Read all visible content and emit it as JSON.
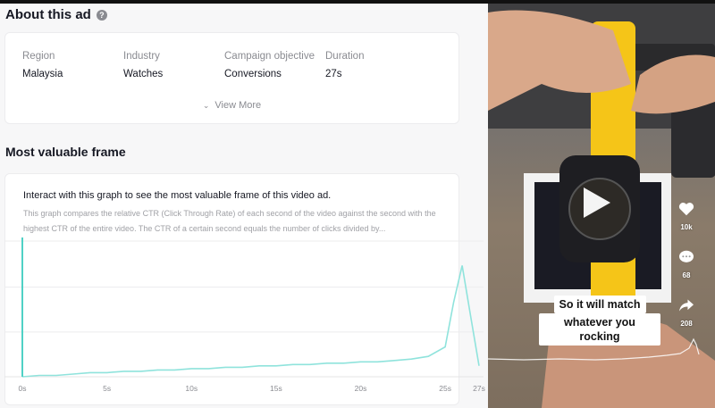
{
  "about": {
    "title": "About this ad",
    "help_icon": "help-icon",
    "fields": [
      {
        "label": "Region",
        "value": "Malaysia"
      },
      {
        "label": "Industry",
        "value": "Watches"
      },
      {
        "label": "Campaign objective",
        "value": "Conversions"
      },
      {
        "label": "Duration",
        "value": "27s"
      }
    ],
    "view_more": "View More"
  },
  "frame": {
    "title": "Most valuable frame",
    "card_title": "Interact with this graph to see the most valuable frame of this video ad.",
    "description": "This graph compares the relative CTR (Click Through Rate) of each second of the video against the second with the highest CTR of the entire video. The CTR of a certain second equals the number of clicks divided by..."
  },
  "colors": {
    "line": "#8fe3dc",
    "marker": "#4fd1c5",
    "brand_yellow": "#f5c518"
  },
  "chart_data": {
    "type": "line",
    "x_ticks": [
      "0s",
      "5s",
      "10s",
      "15s",
      "20s",
      "25s",
      "27s"
    ],
    "x_tick_values": [
      0,
      5,
      10,
      15,
      20,
      25,
      27
    ],
    "xlim": [
      0,
      27
    ],
    "ylim": [
      0,
      100
    ],
    "grid": true,
    "series": [
      {
        "x": [
          0,
          1,
          2,
          3,
          4,
          5,
          6,
          7,
          8,
          9,
          10,
          11,
          12,
          13,
          14,
          15,
          16,
          17,
          18,
          19,
          20,
          21,
          22,
          23,
          24,
          25,
          25.5,
          26,
          26.5,
          27
        ],
        "y": [
          0,
          1,
          1,
          2,
          3,
          3,
          4,
          4,
          5,
          5,
          6,
          6,
          7,
          7,
          8,
          8,
          9,
          9,
          10,
          10,
          11,
          11,
          12,
          13,
          15,
          22,
          55,
          82,
          45,
          8
        ]
      }
    ],
    "selected_x": 0
  },
  "video": {
    "caption_lines": [
      "So it will match",
      "whatever you rocking"
    ],
    "likes": "10k",
    "comments": "68",
    "shares": "208"
  }
}
